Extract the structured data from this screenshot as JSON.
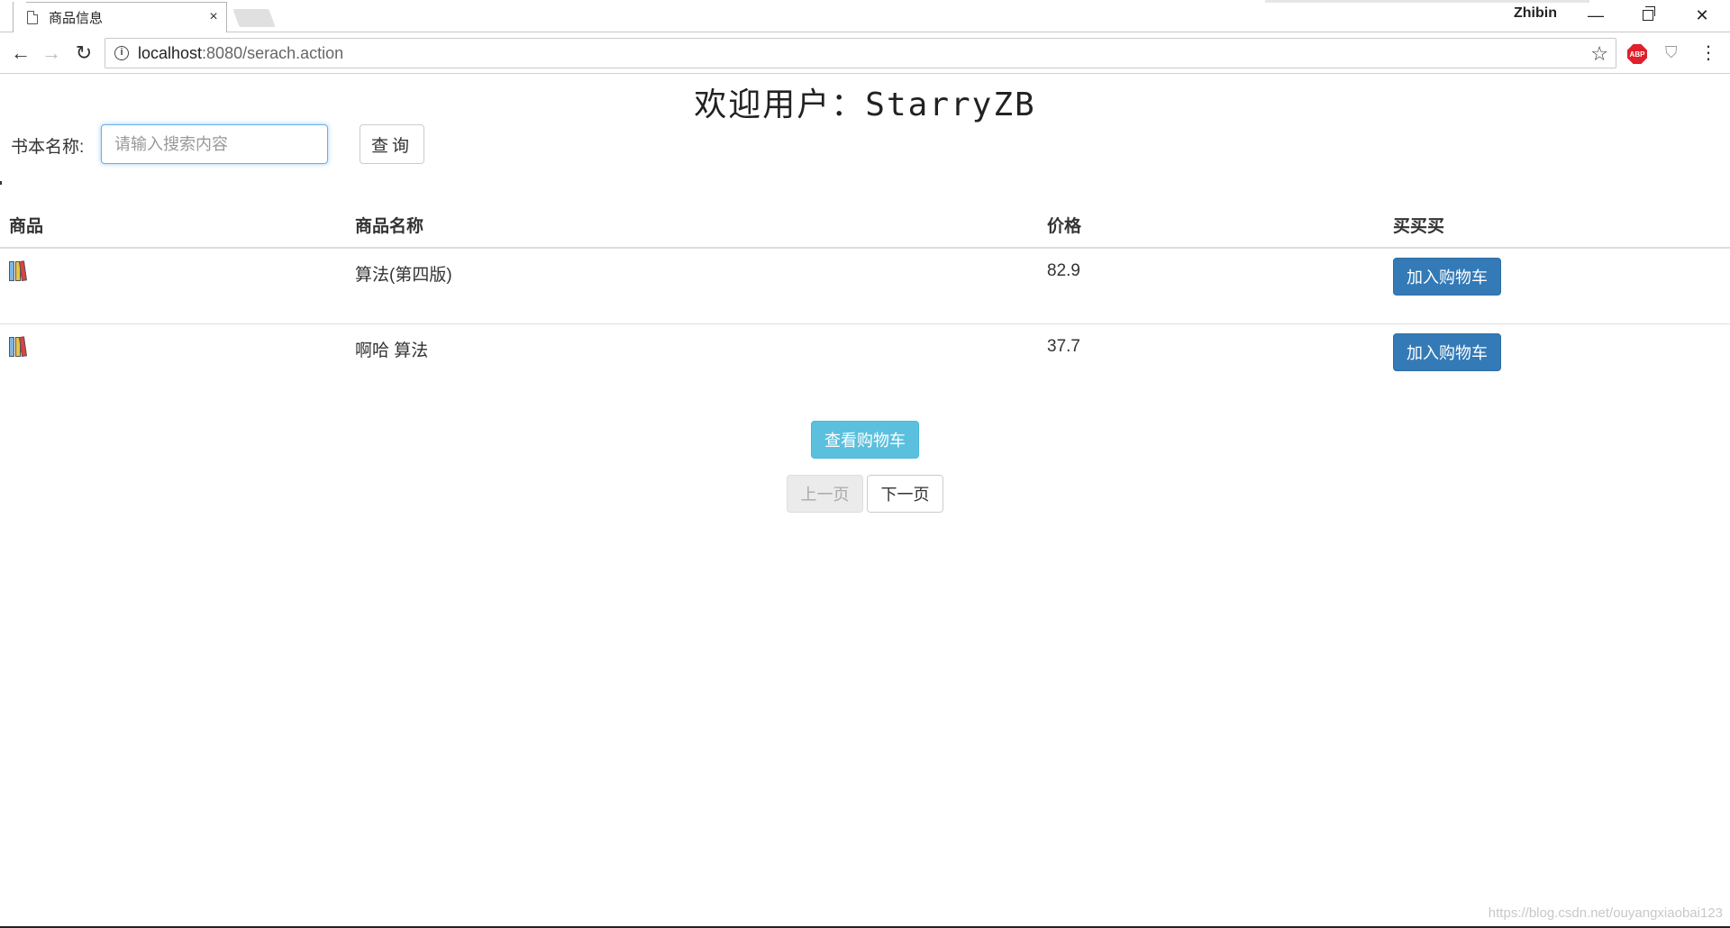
{
  "browser": {
    "tab_title": "商品信息",
    "tab_close": "×",
    "user": "Zhibin",
    "url_host": "localhost",
    "url_rest": ":8080/serach.action",
    "min_glyph": "—",
    "close_glyph": "✕",
    "back_glyph": "←",
    "forward_glyph": "→",
    "reload_glyph": "↻",
    "star_glyph": "☆",
    "abp_label": "ABP",
    "shield_glyph": "⛉",
    "menu_glyph": "⋮",
    "info_glyph": "i"
  },
  "page": {
    "welcome": "欢迎用户：StarryZB",
    "search_label": "书本名称:",
    "search_placeholder": "请输入搜索内容",
    "search_value": "",
    "search_button": "查询"
  },
  "table": {
    "headers": [
      "商品",
      "商品名称",
      "价格",
      "买买买"
    ],
    "rows": [
      {
        "icon": "books-icon",
        "name": "算法(第四版)",
        "price": "82.9",
        "action": "加入购物车"
      },
      {
        "icon": "books-icon",
        "name": "啊哈 算法",
        "price": "37.7",
        "action": "加入购物车"
      }
    ]
  },
  "footer": {
    "view_cart": "查看购物车",
    "prev_page": "上一页",
    "next_page": "下一页"
  },
  "watermark": "https://blog.csdn.net/ouyangxiaobai123",
  "colors": {
    "primary": "#337ab7",
    "info": "#5bc0de",
    "focus": "#66afe9"
  }
}
